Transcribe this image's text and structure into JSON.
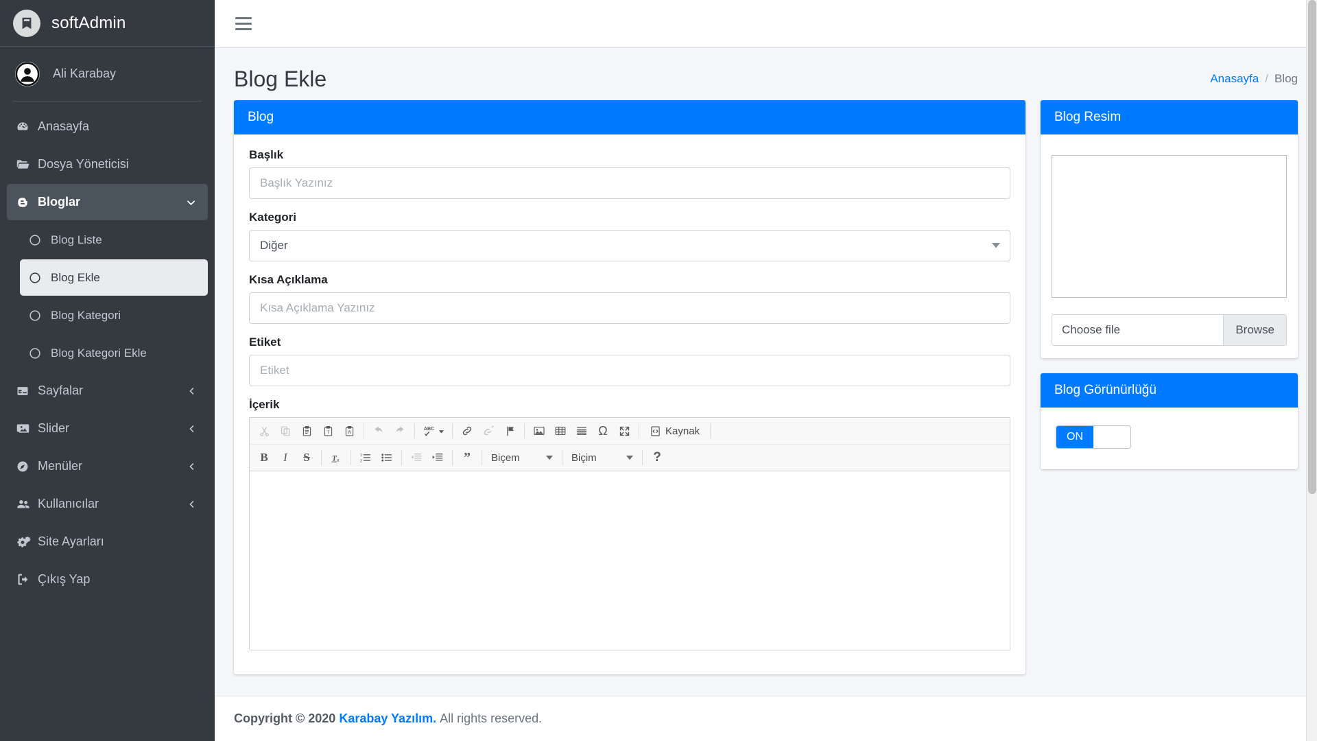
{
  "brand": {
    "name": "softAdmin",
    "logo_icon": "app-logo-icon"
  },
  "user": {
    "name": "Ali Karabay",
    "avatar_icon": "user-avatar-icon"
  },
  "sidebar": {
    "items": [
      {
        "label": "Anasayfa",
        "icon": "tachometer-icon",
        "state": "normal"
      },
      {
        "label": "Dosya Yöneticisi",
        "icon": "folder-open-icon",
        "state": "normal"
      },
      {
        "label": "Bloglar",
        "icon": "blogger-icon",
        "state": "active-parent",
        "caret": "chevron-down-icon"
      },
      {
        "label": "Blog Liste",
        "icon": "circle-icon",
        "state": "sub"
      },
      {
        "label": "Blog Ekle",
        "icon": "circle-icon",
        "state": "sub-active"
      },
      {
        "label": "Blog Kategori",
        "icon": "circle-icon",
        "state": "sub"
      },
      {
        "label": "Blog Kategori Ekle",
        "icon": "circle-icon",
        "state": "sub"
      },
      {
        "label": "Sayfalar",
        "icon": "window-icon",
        "state": "normal",
        "caret": "chevron-left-icon"
      },
      {
        "label": "Slider",
        "icon": "images-icon",
        "state": "normal",
        "caret": "chevron-left-icon"
      },
      {
        "label": "Menüler",
        "icon": "compass-icon",
        "state": "normal",
        "caret": "chevron-left-icon"
      },
      {
        "label": "Kullanıcılar",
        "icon": "users-icon",
        "state": "normal",
        "caret": "chevron-left-icon"
      },
      {
        "label": "Site Ayarları",
        "icon": "cogs-icon",
        "state": "normal"
      },
      {
        "label": "Çıkış Yap",
        "icon": "sign-out-icon",
        "state": "normal"
      }
    ]
  },
  "topbar": {
    "menu_toggle_icon": "hamburger-icon"
  },
  "header": {
    "title": "Blog Ekle",
    "breadcrumb": {
      "home": "Anasayfa",
      "separator": "/",
      "current": "Blog"
    }
  },
  "form_card": {
    "title": "Blog",
    "fields": {
      "baslik": {
        "label": "Başlık",
        "value": "",
        "placeholder": "Başlık Yazınız"
      },
      "kategori": {
        "label": "Kategori",
        "selected": "Diğer",
        "caret_icon": "caret-down-icon"
      },
      "kisa_aciklama": {
        "label": "Kısa Açıklama",
        "value": "",
        "placeholder": "Kısa Açıklama Yazınız"
      },
      "etiket": {
        "label": "Etiket",
        "value": "",
        "placeholder": "Etiket"
      },
      "icerik": {
        "label": "İçerik",
        "value": ""
      }
    }
  },
  "editor": {
    "toolbar_row1": [
      {
        "name": "cut-icon",
        "glyph": "✂",
        "dim": true
      },
      {
        "name": "copy-icon",
        "glyph": "⧉",
        "dim": true
      },
      {
        "name": "paste-icon",
        "glyph": "📋",
        "dim": false
      },
      {
        "name": "paste-text-icon",
        "glyph": "T",
        "dim": false
      },
      {
        "name": "paste-word-icon",
        "glyph": "W",
        "dim": false
      },
      {
        "name": "undo-icon",
        "glyph": "↩",
        "dim": true
      },
      {
        "name": "redo-icon",
        "glyph": "↪",
        "dim": true
      },
      {
        "name": "spellcheck-icon",
        "glyph": "ABC",
        "dim": false
      },
      {
        "name": "link-icon",
        "glyph": "🔗",
        "dim": false
      },
      {
        "name": "unlink-icon",
        "glyph": "⛓",
        "dim": true
      },
      {
        "name": "anchor-flag-icon",
        "glyph": "⚑",
        "dim": false
      },
      {
        "name": "image-icon",
        "glyph": "🖼",
        "dim": false
      },
      {
        "name": "table-icon",
        "glyph": "▦",
        "dim": false
      },
      {
        "name": "horizontal-rule-icon",
        "glyph": "≡",
        "dim": false
      },
      {
        "name": "special-char-icon",
        "glyph": "Ω",
        "dim": false
      },
      {
        "name": "maximize-icon",
        "glyph": "⤢",
        "dim": false
      }
    ],
    "source_button": {
      "label": "Kaynak",
      "icon": "source-code-icon"
    },
    "toolbar_row2": [
      {
        "name": "bold-icon",
        "glyph": "B",
        "dim": false
      },
      {
        "name": "italic-icon",
        "glyph": "I",
        "dim": false
      },
      {
        "name": "strikethrough-icon",
        "glyph": "S",
        "dim": false
      },
      {
        "name": "remove-format-icon",
        "glyph": "Tx",
        "dim": false
      },
      {
        "name": "numbered-list-icon",
        "glyph": "1≡",
        "dim": false
      },
      {
        "name": "bulleted-list-icon",
        "glyph": "•≡",
        "dim": false
      },
      {
        "name": "outdent-icon",
        "glyph": "⇤",
        "dim": true
      },
      {
        "name": "indent-icon",
        "glyph": "⇥",
        "dim": false
      },
      {
        "name": "blockquote-icon",
        "glyph": "❞",
        "dim": false
      }
    ],
    "style_combo": {
      "label": "Biçem",
      "caret_icon": "caret-down-icon"
    },
    "format_combo": {
      "label": "Biçim",
      "caret_icon": "caret-down-icon"
    },
    "help_button": {
      "label": "?",
      "icon": "help-icon"
    }
  },
  "image_card": {
    "title": "Blog Resim",
    "preview_alt": "",
    "file_input": {
      "value": "Choose file",
      "browse_label": "Browse"
    }
  },
  "visibility_card": {
    "title": "Blog Görünürlüğü",
    "toggle": {
      "state_label": "ON",
      "checked": true
    }
  },
  "footer": {
    "copyright_prefix": "Copyright © 2020",
    "company": "Karabay Yazılım.",
    "rights": "All rights reserved."
  },
  "colors": {
    "primary": "#007bff",
    "sidebar_bg": "#343a40",
    "sidebar_active_parent": "#4b545c",
    "sidebar_active_item": "#e9ecef",
    "content_bg": "#f4f6f9"
  }
}
